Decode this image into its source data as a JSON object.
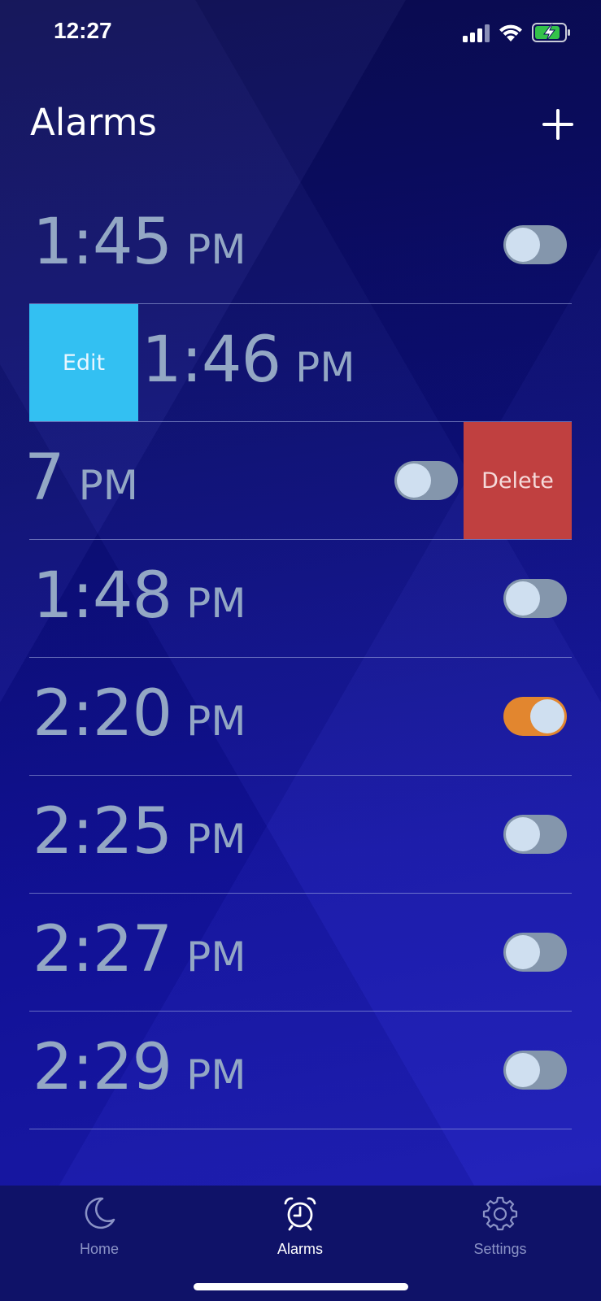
{
  "status_bar": {
    "time": "12:27",
    "icons": [
      "signal-icon",
      "wifi-icon",
      "battery-charging-icon"
    ]
  },
  "header": {
    "title": "Alarms",
    "add_icon": "plus-icon"
  },
  "alarms": [
    {
      "time": "1:45",
      "ampm": "PM",
      "enabled": false,
      "state": "normal"
    },
    {
      "time": "1:46",
      "ampm": "PM",
      "enabled": false,
      "state": "swiped-right",
      "action_label": "Edit"
    },
    {
      "time": "7",
      "ampm": "PM",
      "enabled": false,
      "state": "swiped-left",
      "action_label": "Delete"
    },
    {
      "time": "1:48",
      "ampm": "PM",
      "enabled": false,
      "state": "normal"
    },
    {
      "time": "2:20",
      "ampm": "PM",
      "enabled": true,
      "state": "normal"
    },
    {
      "time": "2:25",
      "ampm": "PM",
      "enabled": false,
      "state": "normal"
    },
    {
      "time": "2:27",
      "ampm": "PM",
      "enabled": false,
      "state": "normal"
    },
    {
      "time": "2:29",
      "ampm": "PM",
      "enabled": false,
      "state": "normal"
    }
  ],
  "tab_bar": {
    "tabs": [
      {
        "label": "Home",
        "icon": "moon-icon",
        "active": false
      },
      {
        "label": "Alarms",
        "icon": "alarm-clock-icon",
        "active": true
      },
      {
        "label": "Settings",
        "icon": "gear-icon",
        "active": false
      }
    ]
  },
  "colors": {
    "toggle_on": "#e2862f",
    "toggle_off": "#8496ac",
    "edit_action": "#33c0f2",
    "delete_action": "#c04040",
    "time_text": "#93a7c4"
  }
}
